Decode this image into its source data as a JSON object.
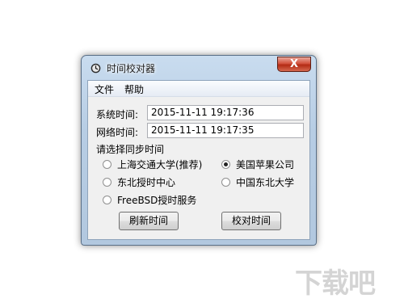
{
  "window": {
    "title": "时间校对器",
    "close_symbol": "X"
  },
  "menu": {
    "items": [
      "文件",
      "帮助"
    ]
  },
  "system_time": {
    "label": "系统时间:",
    "value": "2015-11-11 19:17:36"
  },
  "network_time": {
    "label": "网络时间:",
    "value": "2015-11-11 19:17:35"
  },
  "sync": {
    "heading": "请选择同步时间",
    "options": [
      {
        "label": "上海交通大学(推荐)",
        "selected": false
      },
      {
        "label": "美国苹果公司",
        "selected": true
      },
      {
        "label": "东北授时中心",
        "selected": false
      },
      {
        "label": "中国东北大学",
        "selected": false
      },
      {
        "label": "FreeBSD授时服务",
        "selected": false
      }
    ]
  },
  "buttons": {
    "refresh": "刷新时间",
    "calibrate": "校对时间"
  },
  "watermark": {
    "text": "下载吧"
  }
}
